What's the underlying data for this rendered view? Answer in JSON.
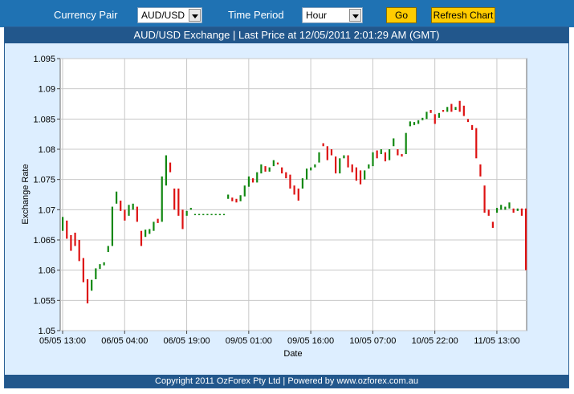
{
  "toolbar": {
    "currency_pair_label": "Currency Pair",
    "currency_pair_value": "AUD/USD",
    "time_period_label": "Time Period",
    "time_period_value": "Hour",
    "go_label": "Go",
    "refresh_label": "Refresh Chart"
  },
  "chart": {
    "header": "AUD/USD Exchange |  Last Price at 12/05/2011 2:01:29 AM (GMT)",
    "footer": "Copyright 2011 OzForex Pty Ltd | Powered by www.ozforex.com.au"
  },
  "colors": {
    "up": "#118811",
    "down": "#dd1111",
    "toolbar": "#1f72b3",
    "header": "#22578c",
    "button": "#ffcc00"
  },
  "chart_data": {
    "type": "candlestick",
    "title": "AUD/USD Exchange |  Last Price at 12/05/2011 2:01:29 AM (GMT)",
    "xlabel": "Date",
    "ylabel": "Exchange Rate",
    "ylim": [
      1.05,
      1.095
    ],
    "y_ticks": [
      "1.095",
      "1.09",
      "1.085",
      "1.08",
      "1.075",
      "1.07",
      "1.065",
      "1.06",
      "1.055",
      "1.05"
    ],
    "x_ticks": [
      "05/05 13:00",
      "06/05 04:00",
      "06/05 19:00",
      "09/05 01:00",
      "09/05 16:00",
      "10/05 07:00",
      "10/05 22:00",
      "11/05 13:00"
    ],
    "grid": true,
    "candles": [
      {
        "i": 0,
        "o": 1.0665,
        "c": 1.0688
      },
      {
        "i": 1,
        "o": 1.0682,
        "c": 1.0652
      },
      {
        "i": 2,
        "o": 1.0658,
        "c": 1.0632
      },
      {
        "i": 3,
        "o": 1.0662,
        "c": 1.064
      },
      {
        "i": 4,
        "o": 1.065,
        "c": 1.0615
      },
      {
        "i": 5,
        "o": 1.062,
        "c": 1.058
      },
      {
        "i": 6,
        "o": 1.0585,
        "c": 1.0545
      },
      {
        "i": 7,
        "o": 1.0566,
        "c": 1.0584
      },
      {
        "i": 8,
        "o": 1.0585,
        "c": 1.0603
      },
      {
        "i": 9,
        "o": 1.0602,
        "c": 1.061
      },
      {
        "i": 10,
        "o": 1.0608,
        "c": 1.0613
      },
      {
        "i": 11,
        "o": 1.063,
        "c": 1.064
      },
      {
        "i": 12,
        "o": 1.064,
        "c": 1.0705
      },
      {
        "i": 13,
        "o": 1.071,
        "c": 1.073
      },
      {
        "i": 14,
        "o": 1.0715,
        "c": 1.0698
      },
      {
        "i": 15,
        "o": 1.07,
        "c": 1.0682
      },
      {
        "i": 16,
        "o": 1.069,
        "c": 1.0708
      },
      {
        "i": 17,
        "o": 1.07,
        "c": 1.071
      },
      {
        "i": 18,
        "o": 1.0705,
        "c": 1.068
      },
      {
        "i": 19,
        "o": 1.0665,
        "c": 1.064
      },
      {
        "i": 20,
        "o": 1.0655,
        "c": 1.0667
      },
      {
        "i": 21,
        "o": 1.066,
        "c": 1.0668
      },
      {
        "i": 22,
        "o": 1.0665,
        "c": 1.068
      },
      {
        "i": 23,
        "o": 1.0685,
        "c": 1.0678
      },
      {
        "i": 24,
        "o": 1.068,
        "c": 1.0755
      },
      {
        "i": 25,
        "o": 1.074,
        "c": 1.079
      },
      {
        "i": 26,
        "o": 1.0778,
        "c": 1.0762
      },
      {
        "i": 27,
        "o": 1.0735,
        "c": 1.07
      },
      {
        "i": 28,
        "o": 1.0735,
        "c": 1.069
      },
      {
        "i": 29,
        "o": 1.07,
        "c": 1.0668
      },
      {
        "i": 30,
        "o": 1.069,
        "c": 1.0698
      },
      {
        "i": 31,
        "o": 1.07,
        "c": 1.0703
      },
      {
        "i": 32,
        "o": 1.0693,
        "c": 1.0693
      },
      {
        "i": 33,
        "o": 1.0693,
        "c": 1.0693
      },
      {
        "i": 34,
        "o": 1.0693,
        "c": 1.0693
      },
      {
        "i": 35,
        "o": 1.0693,
        "c": 1.0693
      },
      {
        "i": 36,
        "o": 1.0693,
        "c": 1.0693
      },
      {
        "i": 37,
        "o": 1.0693,
        "c": 1.0693
      },
      {
        "i": 38,
        "o": 1.0693,
        "c": 1.0693
      },
      {
        "i": 39,
        "o": 1.0693,
        "c": 1.0693
      },
      {
        "i": 40,
        "o": 1.0718,
        "c": 1.0725
      },
      {
        "i": 41,
        "o": 1.072,
        "c": 1.0714
      },
      {
        "i": 42,
        "o": 1.0718,
        "c": 1.0712
      },
      {
        "i": 43,
        "o": 1.0714,
        "c": 1.0724
      },
      {
        "i": 44,
        "o": 1.0722,
        "c": 1.074
      },
      {
        "i": 45,
        "o": 1.0738,
        "c": 1.0755
      },
      {
        "i": 46,
        "o": 1.0752,
        "c": 1.0745
      },
      {
        "i": 47,
        "o": 1.0745,
        "c": 1.0762
      },
      {
        "i": 48,
        "o": 1.076,
        "c": 1.0775
      },
      {
        "i": 49,
        "o": 1.0772,
        "c": 1.0763
      },
      {
        "i": 50,
        "o": 1.0763,
        "c": 1.077
      },
      {
        "i": 51,
        "o": 1.0772,
        "c": 1.0782
      },
      {
        "i": 52,
        "o": 1.0778,
        "c": 1.0775
      },
      {
        "i": 53,
        "o": 1.077,
        "c": 1.076
      },
      {
        "i": 54,
        "o": 1.0762,
        "c": 1.0752
      },
      {
        "i": 55,
        "o": 1.0758,
        "c": 1.0735
      },
      {
        "i": 56,
        "o": 1.074,
        "c": 1.0725
      },
      {
        "i": 57,
        "o": 1.0735,
        "c": 1.0715
      },
      {
        "i": 58,
        "o": 1.0735,
        "c": 1.0752
      },
      {
        "i": 59,
        "o": 1.075,
        "c": 1.0768
      },
      {
        "i": 60,
        "o": 1.0765,
        "c": 1.077
      },
      {
        "i": 61,
        "o": 1.077,
        "c": 1.0775
      },
      {
        "i": 62,
        "o": 1.0778,
        "c": 1.0795
      },
      {
        "i": 63,
        "o": 1.081,
        "c": 1.0805
      },
      {
        "i": 64,
        "o": 1.0805,
        "c": 1.0782
      },
      {
        "i": 65,
        "o": 1.08,
        "c": 1.079
      },
      {
        "i": 66,
        "o": 1.0788,
        "c": 1.076
      },
      {
        "i": 67,
        "o": 1.076,
        "c": 1.0785
      },
      {
        "i": 68,
        "o": 1.0785,
        "c": 1.079
      },
      {
        "i": 69,
        "o": 1.079,
        "c": 1.077
      },
      {
        "i": 70,
        "o": 1.0775,
        "c": 1.0762
      },
      {
        "i": 71,
        "o": 1.077,
        "c": 1.0748
      },
      {
        "i": 72,
        "o": 1.0765,
        "c": 1.0742
      },
      {
        "i": 73,
        "o": 1.075,
        "c": 1.0765
      },
      {
        "i": 74,
        "o": 1.0768,
        "c": 1.0775
      },
      {
        "i": 75,
        "o": 1.0772,
        "c": 1.0795
      },
      {
        "i": 76,
        "o": 1.0798,
        "c": 1.0785
      },
      {
        "i": 77,
        "o": 1.0792,
        "c": 1.08
      },
      {
        "i": 78,
        "o": 1.0795,
        "c": 1.078
      },
      {
        "i": 79,
        "o": 1.0782,
        "c": 1.08
      },
      {
        "i": 80,
        "o": 1.0805,
        "c": 1.0818
      },
      {
        "i": 81,
        "o": 1.08,
        "c": 1.079
      },
      {
        "i": 82,
        "o": 1.0792,
        "c": 1.0788
      },
      {
        "i": 83,
        "o": 1.0792,
        "c": 1.0827
      },
      {
        "i": 84,
        "o": 1.0838,
        "c": 1.0846
      },
      {
        "i": 85,
        "o": 1.084,
        "c": 1.0845
      },
      {
        "i": 86,
        "o": 1.0842,
        "c": 1.0848
      },
      {
        "i": 87,
        "o": 1.0848,
        "c": 1.0852
      },
      {
        "i": 88,
        "o": 1.085,
        "c": 1.0862
      },
      {
        "i": 89,
        "o": 1.0865,
        "c": 1.086
      },
      {
        "i": 90,
        "o": 1.0858,
        "c": 1.0842
      },
      {
        "i": 91,
        "o": 1.0852,
        "c": 1.086
      },
      {
        "i": 92,
        "o": 1.0865,
        "c": 1.0862
      },
      {
        "i": 93,
        "o": 1.0862,
        "c": 1.087
      },
      {
        "i": 94,
        "o": 1.0875,
        "c": 1.0862
      },
      {
        "i": 95,
        "o": 1.0865,
        "c": 1.087
      },
      {
        "i": 96,
        "o": 1.088,
        "c": 1.0862
      },
      {
        "i": 97,
        "o": 1.0872,
        "c": 1.0855
      },
      {
        "i": 98,
        "o": 1.085,
        "c": 1.0845
      },
      {
        "i": 99,
        "o": 1.084,
        "c": 1.0832
      },
      {
        "i": 100,
        "o": 1.0835,
        "c": 1.0785
      },
      {
        "i": 101,
        "o": 1.0775,
        "c": 1.0755
      },
      {
        "i": 102,
        "o": 1.074,
        "c": 1.0695
      },
      {
        "i": 103,
        "o": 1.07,
        "c": 1.069
      },
      {
        "i": 104,
        "o": 1.068,
        "c": 1.067
      },
      {
        "i": 105,
        "o": 1.0695,
        "c": 1.0703
      },
      {
        "i": 106,
        "o": 1.07,
        "c": 1.0708
      },
      {
        "i": 107,
        "o": 1.07,
        "c": 1.0705
      },
      {
        "i": 108,
        "o": 1.0702,
        "c": 1.0712
      },
      {
        "i": 109,
        "o": 1.0702,
        "c": 1.0695
      },
      {
        "i": 110,
        "o": 1.0698,
        "c": 1.0702
      },
      {
        "i": 111,
        "o": 1.0702,
        "c": 1.069
      },
      {
        "i": 112,
        "o": 1.0702,
        "c": 1.06
      }
    ]
  }
}
